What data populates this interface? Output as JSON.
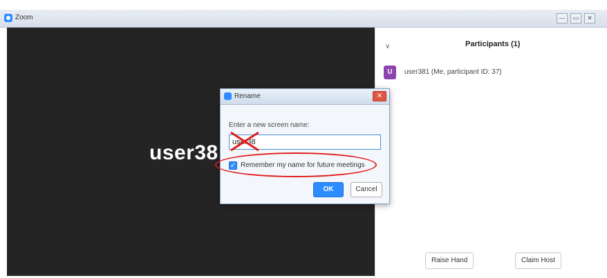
{
  "window": {
    "title": "Zoom",
    "controls": [
      "minimize-icon",
      "maximize-icon",
      "close-icon"
    ],
    "minimize_glyph": "—",
    "maximize_glyph": "▭",
    "close_glyph": "✕"
  },
  "video": {
    "display_name": "user38"
  },
  "participants_panel": {
    "collapse_glyph": "∨",
    "title": "Participants (1)",
    "participants": [
      {
        "avatar_letter": "U",
        "avatar_color": "#8e44ad",
        "name": "user381 (Me, participant ID: 37)"
      }
    ],
    "raise_hand_label": "Raise Hand",
    "claim_host_label": "Claim Host"
  },
  "rename_dialog": {
    "title": "Rename",
    "close_glyph": "✕",
    "prompt": "Enter a new screen name:",
    "input_value": "user38",
    "remember_checked": true,
    "check_glyph": "✓",
    "remember_label": "Remember my name for future meetings",
    "ok_label": "OK",
    "cancel_label": "Cancel"
  },
  "colors": {
    "accent": "#2d8cff",
    "annotation": "#e11b1b",
    "video_bg": "#242424"
  }
}
